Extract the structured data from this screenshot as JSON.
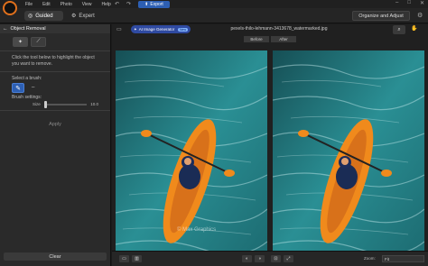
{
  "window": {
    "menu": [
      "File",
      "Edit",
      "Photo",
      "View",
      "Help"
    ],
    "undo_icon": "undo-icon",
    "redo_icon": "redo-icon",
    "export_label": "Export",
    "controls": [
      "–",
      "□",
      "✕"
    ]
  },
  "modes": {
    "guided": "Guided",
    "expert": "Expert",
    "organize": "Organize and Adjust"
  },
  "panel": {
    "title": "Object Removal",
    "instructions": "Click the tool below to highlight the object you want to remove.",
    "select_brush": "Select a brush:",
    "brush_settings": "Brush settings:",
    "size_label": "Size",
    "size_value": "10.0",
    "size_fraction": 0.0,
    "apply": "Apply",
    "clear": "Clear"
  },
  "main": {
    "ai_label": "AI Image Generator",
    "ai_badge": "New",
    "filename": "pexels-thilo-lehmann-3413678_watermarked.jpg",
    "before": "Before",
    "after": "After",
    "watermark": "© Max Graphics",
    "zoom_label": "Zoom:",
    "zoom_value": "Fit"
  },
  "colors": {
    "accent": "#2d5fb3",
    "water": "#2a8f94",
    "kayak": "#f08a1c"
  }
}
